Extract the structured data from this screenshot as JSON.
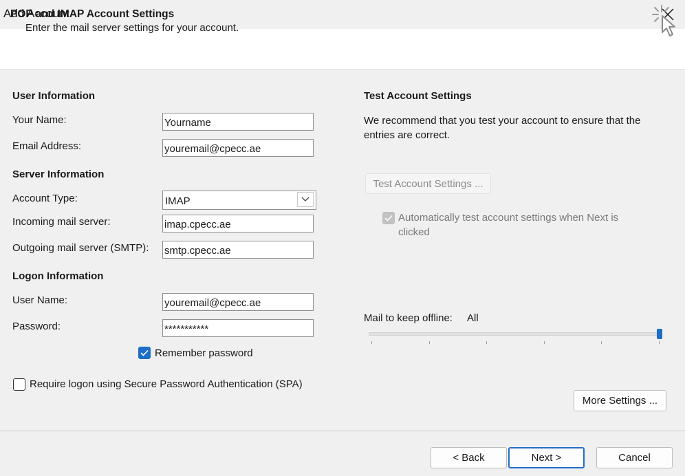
{
  "window": {
    "title": "Add Account",
    "close_icon": "close-icon"
  },
  "header": {
    "title": "POP and IMAP Account Settings",
    "subtitle": "Enter the mail server settings for your account.",
    "icon": "cursor-click-icon"
  },
  "user_info": {
    "heading": "User Information",
    "name_label": "Your Name:",
    "name_value": "Yourname",
    "email_label": "Email Address:",
    "email_value": "youremail@cpecc.ae"
  },
  "server_info": {
    "heading": "Server Information",
    "account_type_label": "Account Type:",
    "account_type_value": "IMAP",
    "incoming_label": "Incoming mail server:",
    "incoming_value": "imap.cpecc.ae",
    "outgoing_label": "Outgoing mail server (SMTP):",
    "outgoing_value": "smtp.cpecc.ae"
  },
  "logon_info": {
    "heading": "Logon Information",
    "username_label": "User Name:",
    "username_value": "youremail@cpecc.ae",
    "password_label": "Password:",
    "password_value": "***********",
    "remember_label": "Remember password",
    "remember_checked": true,
    "spa_label": "Require logon using Secure Password Authentication (SPA)",
    "spa_checked": false
  },
  "test_settings": {
    "heading": "Test Account Settings",
    "description": "We recommend that you test your account to ensure that the entries are correct.",
    "test_button": "Test Account Settings ...",
    "auto_test_label": "Automatically test account settings when Next is clicked",
    "auto_test_checked": true
  },
  "offline": {
    "label": "Mail to keep offline:",
    "value": "All",
    "slider_level": 1.0
  },
  "more_settings_button": "More Settings ...",
  "footer": {
    "back_button": "< Back",
    "next_button": "Next >",
    "cancel_button": "Cancel"
  },
  "colors": {
    "accent": "#1e6ec8",
    "background": "#f0f0f0",
    "header_bg": "#ffffff"
  }
}
